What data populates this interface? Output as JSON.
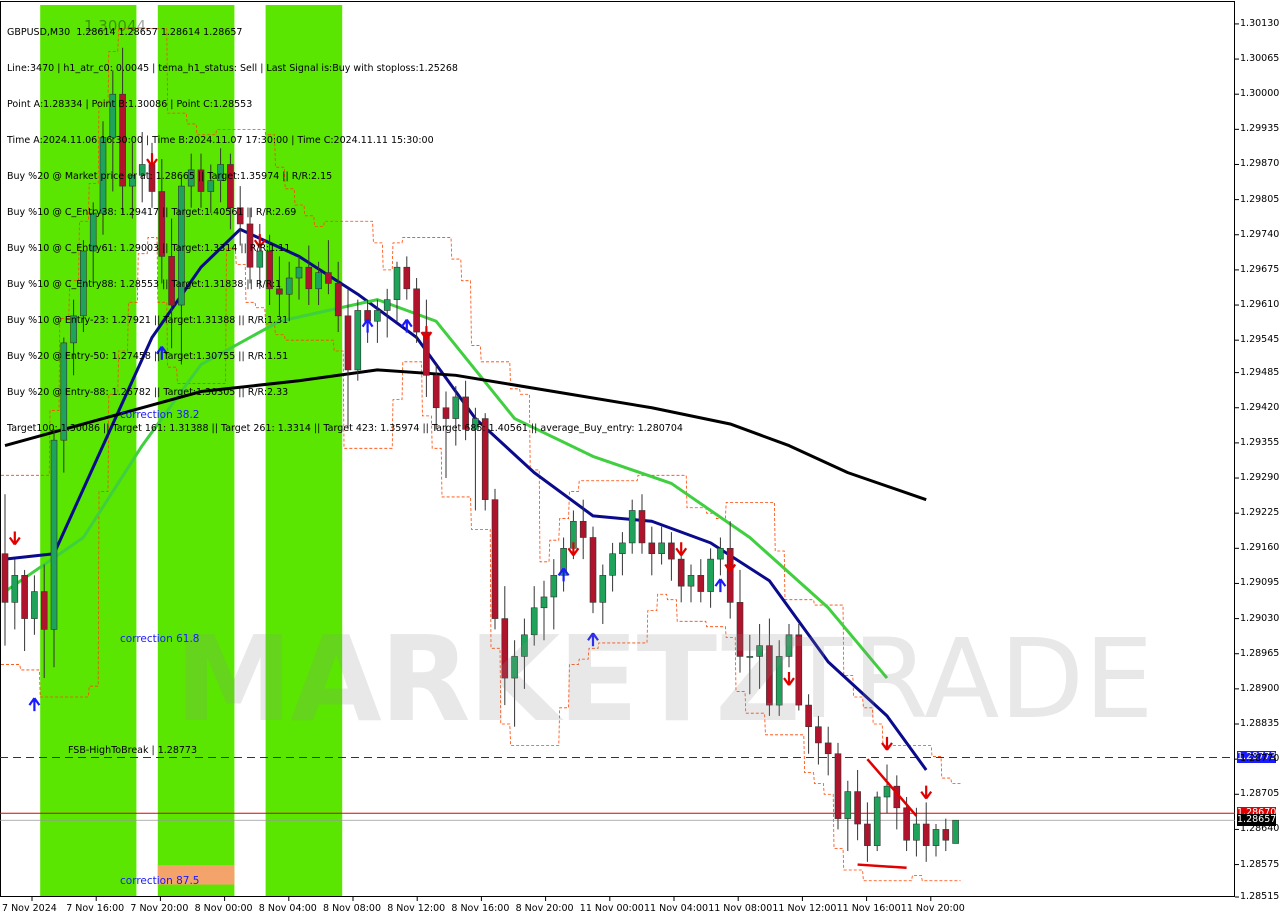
{
  "header": {
    "symbol_line": "GBPUSD,M30  1.28614 1.28657 1.28614 1.28657",
    "info_lines": [
      "Line:3470 | h1_atr_c0: 0.0045 | tema_h1_status: Sell | Last Signal is:Buy with stoploss:1.25268",
      "Point A:1.28334 | Point B:1.30086 | Point C:1.28553",
      "Time A:2024.11.06 16:30:00 | Time B:2024.11.07 17:30:00 | Time C:2024.11.11 15:30:00",
      "Buy %20 @ Market price or at: 1.28665 || Target:1.35974 || R/R:2.15",
      "Buy %10 @ C_Entry38: 1.29417 || Target:1.40561 || R/R:2.69",
      "Buy %10 @ C_Entry61: 1.29003 || Target:1.3314 || R/R:1.11",
      "Buy %10 @ C_Entry88: 1.28553 || Target:1.31838 || R/R:1",
      "Buy %10 @ Entry-23: 1.27921 || Target:1.31388 || R/R:1.31",
      "Buy %20 @ Entry-50: 1.27458 || Target:1.30755 || R/R:1.51",
      "Buy %20 @ Entry-88: 1.26782 || Target:1.30305 || R/R:2.33",
      "Target100: 1.30086 || Target 161: 1.31388 || Target 261: 1.3314 || Target 423: 1.35974 || Target 685: 1.40561 || average_Buy_entry: 1.280704"
    ],
    "overlay_number": "1.30044"
  },
  "labels": {
    "correction_38": "correction 38.2",
    "correction_61": "correction 61.8",
    "correction_87": "correction 87.5",
    "fsb": "FSB-HighToBreak | 1.28773"
  },
  "price_boxes": {
    "blue_line": "1.28773",
    "red_line": "1.28670",
    "current": "1.28657"
  },
  "watermark": {
    "part1": "MARKETZ",
    "part2": "TRADE"
  },
  "colors": {
    "bull": "#1fa35b",
    "bear": "#b0142c",
    "zone_green": "#5ae600",
    "zone_orange": "#f4a46a",
    "ma_blue": "#0a0a8c",
    "ma_green": "#3fcf3f",
    "ma_black": "#000000",
    "level_blue": "#1a1aff",
    "level_red": "#e00000",
    "channel": "#ff4500"
  },
  "chart_data": {
    "type": "candlestick",
    "symbol": "GBPUSD",
    "timeframe": "M30",
    "ylim": [
      1.28515,
      1.30165
    ],
    "y_ticks": [
      "1.30130",
      "1.30065",
      "1.30000",
      "1.29935",
      "1.29870",
      "1.29805",
      "1.29740",
      "1.29675",
      "1.29610",
      "1.29545",
      "1.29485",
      "1.29420",
      "1.29355",
      "1.29290",
      "1.29225",
      "1.29160",
      "1.29095",
      "1.29030",
      "1.28965",
      "1.28900",
      "1.28835",
      "1.28770",
      "1.28705",
      "1.28640",
      "1.28575",
      "1.28515"
    ],
    "x_ticks": [
      "7 Nov 2024",
      "7 Nov 16:00",
      "7 Nov 20:00",
      "8 Nov 00:00",
      "8 Nov 04:00",
      "8 Nov 08:00",
      "8 Nov 12:00",
      "8 Nov 16:00",
      "8 Nov 20:00",
      "11 Nov 00:00",
      "11 Nov 04:00",
      "11 Nov 08:00",
      "11 Nov 12:00",
      "11 Nov 16:00",
      "11 Nov 20:00"
    ],
    "levels": {
      "fsb_high_to_break": 1.28773,
      "red_level": 1.2867,
      "current": 1.28657
    },
    "candles": [
      [
        1.2915,
        1.2926,
        1.2898,
        1.2906
      ],
      [
        1.2906,
        1.2914,
        1.2901,
        1.2911
      ],
      [
        1.2911,
        1.2912,
        1.2897,
        1.2903
      ],
      [
        1.2903,
        1.2911,
        1.29,
        1.2908
      ],
      [
        1.2908,
        1.2913,
        1.2892,
        1.2901
      ],
      [
        1.2901,
        1.2938,
        1.2894,
        1.2936
      ],
      [
        1.2936,
        1.2955,
        1.293,
        1.2954
      ],
      [
        1.2954,
        1.2962,
        1.2948,
        1.2959
      ],
      [
        1.2959,
        1.2973,
        1.2956,
        1.2971
      ],
      [
        1.2971,
        1.298,
        1.2965,
        1.2978
      ],
      [
        1.2978,
        1.2995,
        1.2974,
        1.2992
      ],
      [
        1.2992,
        1.30044,
        1.2982,
        1.3
      ],
      [
        1.3,
        1.30086,
        1.2978,
        1.2983
      ],
      [
        1.2983,
        1.2991,
        1.2977,
        1.2985
      ],
      [
        1.2985,
        1.2993,
        1.298,
        1.2987
      ],
      [
        1.2987,
        1.2991,
        1.2979,
        1.2982
      ],
      [
        1.2982,
        1.2988,
        1.2965,
        1.297
      ],
      [
        1.297,
        1.2977,
        1.2953,
        1.2961
      ],
      [
        1.2961,
        1.2985,
        1.295,
        1.2983
      ],
      [
        1.2983,
        1.2989,
        1.2979,
        1.2986
      ],
      [
        1.2986,
        1.2989,
        1.2979,
        1.2982
      ],
      [
        1.2982,
        1.2987,
        1.2978,
        1.2984
      ],
      [
        1.2984,
        1.299,
        1.298,
        1.2987
      ],
      [
        1.2987,
        1.2989,
        1.2975,
        1.2979
      ],
      [
        1.2979,
        1.2983,
        1.2972,
        1.2976
      ],
      [
        1.2976,
        1.2979,
        1.2965,
        1.2968
      ],
      [
        1.2968,
        1.2976,
        1.2964,
        1.2971
      ],
      [
        1.2971,
        1.2974,
        1.2961,
        1.2964
      ],
      [
        1.2964,
        1.297,
        1.2959,
        1.2963
      ],
      [
        1.2963,
        1.2969,
        1.2958,
        1.2966
      ],
      [
        1.2966,
        1.297,
        1.2962,
        1.2968
      ],
      [
        1.2968,
        1.2972,
        1.2961,
        1.2964
      ],
      [
        1.2964,
        1.2969,
        1.2961,
        1.2967
      ],
      [
        1.2967,
        1.2973,
        1.2963,
        1.2965
      ],
      [
        1.2965,
        1.2969,
        1.2956,
        1.2959
      ],
      [
        1.2959,
        1.2964,
        1.2938,
        1.2949
      ],
      [
        1.2949,
        1.2962,
        1.2947,
        1.296
      ],
      [
        1.296,
        1.2962,
        1.2954,
        1.2958
      ],
      [
        1.2958,
        1.2962,
        1.2954,
        1.296
      ],
      [
        1.296,
        1.2964,
        1.2955,
        1.2962
      ],
      [
        1.2962,
        1.2969,
        1.2958,
        1.2968
      ],
      [
        1.2968,
        1.297,
        1.2962,
        1.2964
      ],
      [
        1.2964,
        1.2966,
        1.2954,
        1.2956
      ],
      [
        1.2956,
        1.2962,
        1.2944,
        1.2948
      ],
      [
        1.2948,
        1.295,
        1.2938,
        1.2942
      ],
      [
        1.2942,
        1.2945,
        1.2929,
        1.294
      ],
      [
        1.294,
        1.2946,
        1.2935,
        1.2944
      ],
      [
        1.2944,
        1.2947,
        1.2936,
        1.2938
      ],
      [
        1.2938,
        1.2942,
        1.2923,
        1.294
      ],
      [
        1.294,
        1.2941,
        1.2923,
        1.2925
      ],
      [
        1.2925,
        1.2927,
        1.2901,
        1.2903
      ],
      [
        1.2903,
        1.2909,
        1.2887,
        1.2892
      ],
      [
        1.2892,
        1.2899,
        1.2883,
        1.2896
      ],
      [
        1.2896,
        1.2903,
        1.289,
        1.29
      ],
      [
        1.29,
        1.2909,
        1.2898,
        1.2905
      ],
      [
        1.2905,
        1.291,
        1.2899,
        1.2907
      ],
      [
        1.2907,
        1.2914,
        1.2901,
        1.2911
      ],
      [
        1.2911,
        1.2918,
        1.2908,
        1.2916
      ],
      [
        1.2916,
        1.2923,
        1.2914,
        1.2921
      ],
      [
        1.2921,
        1.2925,
        1.2914,
        1.2918
      ],
      [
        1.2918,
        1.292,
        1.2904,
        1.2906
      ],
      [
        1.2906,
        1.2913,
        1.2902,
        1.2911
      ],
      [
        1.2911,
        1.2917,
        1.2908,
        1.2915
      ],
      [
        1.2915,
        1.2919,
        1.2911,
        1.2917
      ],
      [
        1.2917,
        1.2925,
        1.2915,
        1.2923
      ],
      [
        1.2923,
        1.2926,
        1.2915,
        1.2917
      ],
      [
        1.2917,
        1.292,
        1.2911,
        1.2915
      ],
      [
        1.2915,
        1.292,
        1.2913,
        1.2917
      ],
      [
        1.2917,
        1.2919,
        1.291,
        1.2914
      ],
      [
        1.2914,
        1.2916,
        1.2906,
        1.2909
      ],
      [
        1.2909,
        1.2913,
        1.2906,
        1.2911
      ],
      [
        1.2911,
        1.2914,
        1.2906,
        1.2908
      ],
      [
        1.2908,
        1.2916,
        1.2905,
        1.2914
      ],
      [
        1.2914,
        1.2918,
        1.2911,
        1.2916
      ],
      [
        1.2916,
        1.2921,
        1.2903,
        1.2906
      ],
      [
        1.2906,
        1.2912,
        1.2893,
        1.2896
      ],
      [
        1.2896,
        1.29,
        1.2889,
        1.2896
      ],
      [
        1.2896,
        1.2902,
        1.289,
        1.2898
      ],
      [
        1.2898,
        1.2903,
        1.2885,
        1.2887
      ],
      [
        1.2887,
        1.2899,
        1.2885,
        1.2896
      ],
      [
        1.2896,
        1.2902,
        1.2894,
        1.29
      ],
      [
        1.29,
        1.2902,
        1.2886,
        1.2887
      ],
      [
        1.2887,
        1.2889,
        1.2878,
        1.2883
      ],
      [
        1.2883,
        1.2885,
        1.2876,
        1.288
      ],
      [
        1.288,
        1.2883,
        1.2874,
        1.2878
      ],
      [
        1.2878,
        1.288,
        1.2864,
        1.2866
      ],
      [
        1.2866,
        1.2873,
        1.286,
        1.2871
      ],
      [
        1.2871,
        1.2875,
        1.2862,
        1.2865
      ],
      [
        1.2865,
        1.2869,
        1.2858,
        1.2861
      ],
      [
        1.2861,
        1.2871,
        1.286,
        1.287
      ],
      [
        1.287,
        1.2876,
        1.2867,
        1.2872
      ],
      [
        1.2872,
        1.2874,
        1.2864,
        1.2868
      ],
      [
        1.2868,
        1.287,
        1.286,
        1.2862
      ],
      [
        1.2862,
        1.2868,
        1.2859,
        1.2865
      ],
      [
        1.2865,
        1.2869,
        1.2858,
        1.2861
      ],
      [
        1.2861,
        1.2865,
        1.2859,
        1.2864
      ],
      [
        1.2864,
        1.2866,
        1.286,
        1.2862
      ],
      [
        1.28614,
        1.28657,
        1.28614,
        1.28657
      ]
    ],
    "moving_averages": [
      {
        "color": "#0a0a8c",
        "points": [
          [
            0,
            1.2914
          ],
          [
            5,
            1.2915
          ],
          [
            10,
            1.2935
          ],
          [
            15,
            1.2955
          ],
          [
            20,
            1.2968
          ],
          [
            24,
            1.2975
          ],
          [
            30,
            1.297
          ],
          [
            36,
            1.2963
          ],
          [
            42,
            1.2955
          ],
          [
            48,
            1.294
          ],
          [
            54,
            1.293
          ],
          [
            60,
            1.2922
          ],
          [
            66,
            1.2921
          ],
          [
            72,
            1.2917
          ],
          [
            78,
            1.291
          ],
          [
            84,
            1.2895
          ],
          [
            90,
            1.2885
          ],
          [
            94,
            1.2875
          ]
        ]
      },
      {
        "color": "#3fcf3f",
        "points": [
          [
            0,
            1.2908
          ],
          [
            8,
            1.2918
          ],
          [
            14,
            1.2935
          ],
          [
            20,
            1.295
          ],
          [
            28,
            1.2958
          ],
          [
            38,
            1.2962
          ],
          [
            44,
            1.2958
          ],
          [
            52,
            1.294
          ],
          [
            60,
            1.2933
          ],
          [
            68,
            1.2928
          ],
          [
            76,
            1.2918
          ],
          [
            84,
            1.2905
          ],
          [
            90,
            1.2892
          ]
        ]
      },
      {
        "color": "#000000",
        "points": [
          [
            0,
            1.2935
          ],
          [
            10,
            1.294
          ],
          [
            20,
            1.2945
          ],
          [
            30,
            1.2947
          ],
          [
            38,
            1.2949
          ],
          [
            46,
            1.2948
          ],
          [
            56,
            1.2945
          ],
          [
            66,
            1.2942
          ],
          [
            74,
            1.2939
          ],
          [
            80,
            1.2935
          ],
          [
            86,
            1.293
          ],
          [
            94,
            1.2925
          ]
        ]
      }
    ],
    "zones": [
      {
        "from": 4,
        "to": 13,
        "color": "#5ae600"
      },
      {
        "from": 16,
        "to": 23,
        "color": "#5ae600"
      },
      {
        "from": 27,
        "to": 34,
        "color": "#5ae600"
      }
    ],
    "orange_zone": {
      "from": 16,
      "to": 23,
      "y_top": 1.28574,
      "y_bottom": 1.28538
    }
  }
}
